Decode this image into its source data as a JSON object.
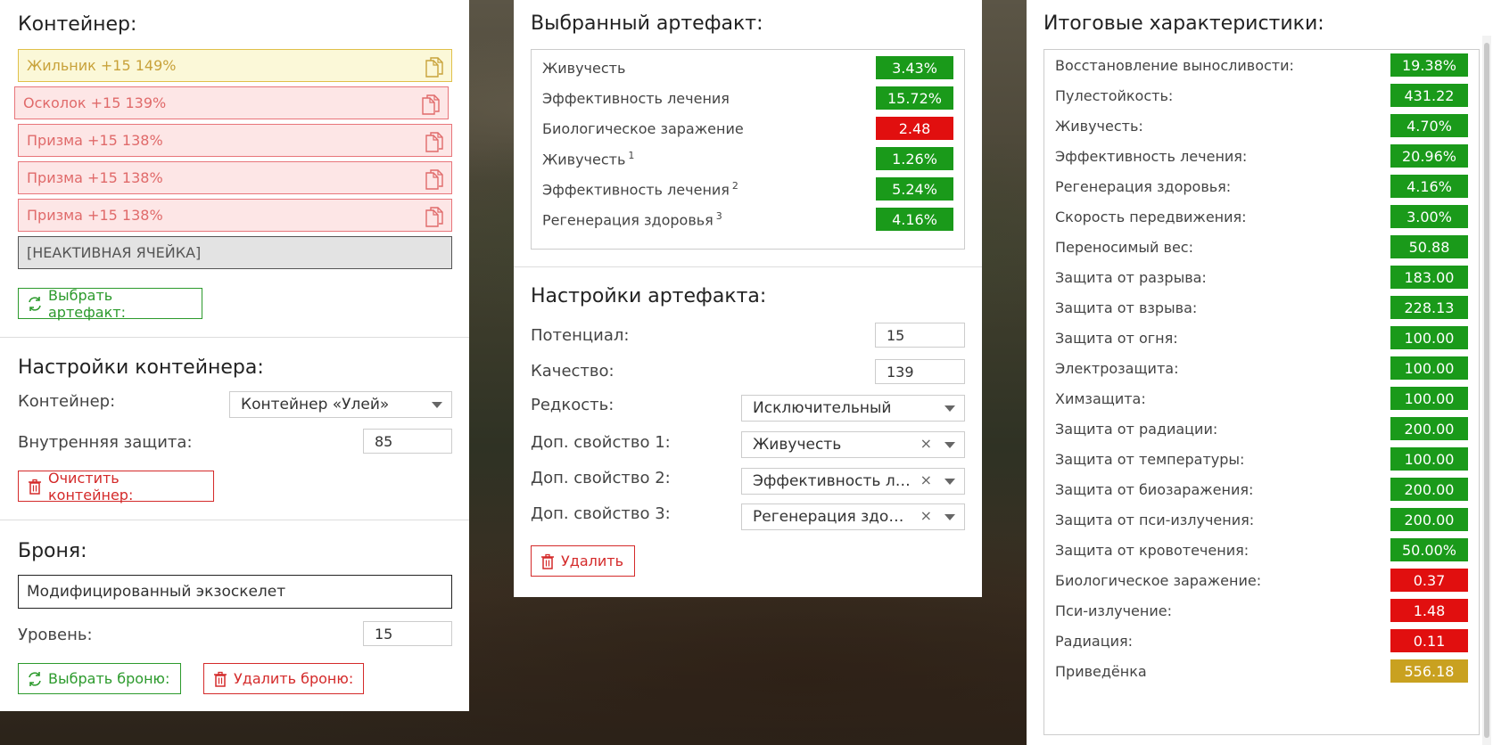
{
  "container": {
    "title": "Контейнер:",
    "slots": [
      {
        "label": "Жильник +15 149%",
        "state": "yellow"
      },
      {
        "label": "Осколок +15 139%",
        "state": "red"
      },
      {
        "label": "Призма +15 138%",
        "state": "red"
      },
      {
        "label": "Призма +15 138%",
        "state": "red"
      },
      {
        "label": "Призма +15 138%",
        "state": "red"
      },
      {
        "label": "[НЕАКТИВНАЯ ЯЧЕЙКА]",
        "state": "gray"
      }
    ],
    "select_artifact_label": "Выбрать артефакт:"
  },
  "container_settings": {
    "title": "Настройки контейнера:",
    "container_label": "Контейнер:",
    "container_value": "Контейнер «Улей»",
    "inner_protection_label": "Внутренняя защита:",
    "inner_protection_value": "85",
    "clear_label": "Очистить контейнер:"
  },
  "armor": {
    "title": "Броня:",
    "name": "Модифицированный экзоскелет",
    "level_label": "Уровень:",
    "level_value": "15",
    "select_label": "Выбрать броню:",
    "delete_label": "Удалить броню:"
  },
  "selected_artifact": {
    "title": "Выбранный артефакт:",
    "stats": [
      {
        "label": "Живучесть",
        "sup": "",
        "value": "3.43%",
        "color": "green"
      },
      {
        "label": "Эффективность лечения",
        "sup": "",
        "value": "15.72%",
        "color": "green"
      },
      {
        "label": "Биологическое заражение",
        "sup": "",
        "value": "2.48",
        "color": "red"
      },
      {
        "label": "Живучесть",
        "sup": "1",
        "value": "1.26%",
        "color": "green"
      },
      {
        "label": "Эффективность лечения",
        "sup": "2",
        "value": "5.24%",
        "color": "green"
      },
      {
        "label": "Регенерация здоровья",
        "sup": "3",
        "value": "4.16%",
        "color": "green"
      }
    ]
  },
  "artifact_settings": {
    "title": "Настройки артефакта:",
    "potential_label": "Потенциал:",
    "potential_value": "15",
    "quality_label": "Качество:",
    "quality_value": "139",
    "rarity_label": "Редкость:",
    "rarity_value": "Исключительный",
    "prop1_label": "Доп. свойство 1:",
    "prop1_value": "Живучесть",
    "prop2_label": "Доп. свойство 2:",
    "prop2_value": "Эффективность лечения",
    "prop3_label": "Доп. свойство 3:",
    "prop3_value": "Регенерация здоровья",
    "clear_symbol": "×",
    "delete_label": "Удалить"
  },
  "totals": {
    "title": "Итоговые характеристики:",
    "stats": [
      {
        "label": "Восстановление выносливости:",
        "value": "19.38%",
        "color": "green"
      },
      {
        "label": "Пулестойкость:",
        "value": "431.22",
        "color": "green"
      },
      {
        "label": "Живучесть:",
        "value": "4.70%",
        "color": "green"
      },
      {
        "label": "Эффективность лечения:",
        "value": "20.96%",
        "color": "green"
      },
      {
        "label": "Регенерация здоровья:",
        "value": "4.16%",
        "color": "green"
      },
      {
        "label": "Скорость передвижения:",
        "value": "3.00%",
        "color": "green"
      },
      {
        "label": "Переносимый вес:",
        "value": "50.88",
        "color": "green"
      },
      {
        "label": "Защита от разрыва:",
        "value": "183.00",
        "color": "green"
      },
      {
        "label": "Защита от взрыва:",
        "value": "228.13",
        "color": "green"
      },
      {
        "label": "Защита от огня:",
        "value": "100.00",
        "color": "green"
      },
      {
        "label": "Электрозащита:",
        "value": "100.00",
        "color": "green"
      },
      {
        "label": "Химзащита:",
        "value": "100.00",
        "color": "green"
      },
      {
        "label": "Защита от радиации:",
        "value": "200.00",
        "color": "green"
      },
      {
        "label": "Защита от температуры:",
        "value": "100.00",
        "color": "green"
      },
      {
        "label": "Защита от биозаражения:",
        "value": "200.00",
        "color": "green"
      },
      {
        "label": "Защита от пси-излучения:",
        "value": "200.00",
        "color": "green"
      },
      {
        "label": "Защита от кровотечения:",
        "value": "50.00%",
        "color": "green"
      },
      {
        "label": "Биологическое заражение:",
        "value": "0.37",
        "color": "red"
      },
      {
        "label": "Пси-излучение:",
        "value": "1.48",
        "color": "red"
      },
      {
        "label": "Радиация:",
        "value": "0.11",
        "color": "red"
      },
      {
        "label": "Приведёнка",
        "value": "556.18",
        "color": "yellow"
      }
    ]
  }
}
